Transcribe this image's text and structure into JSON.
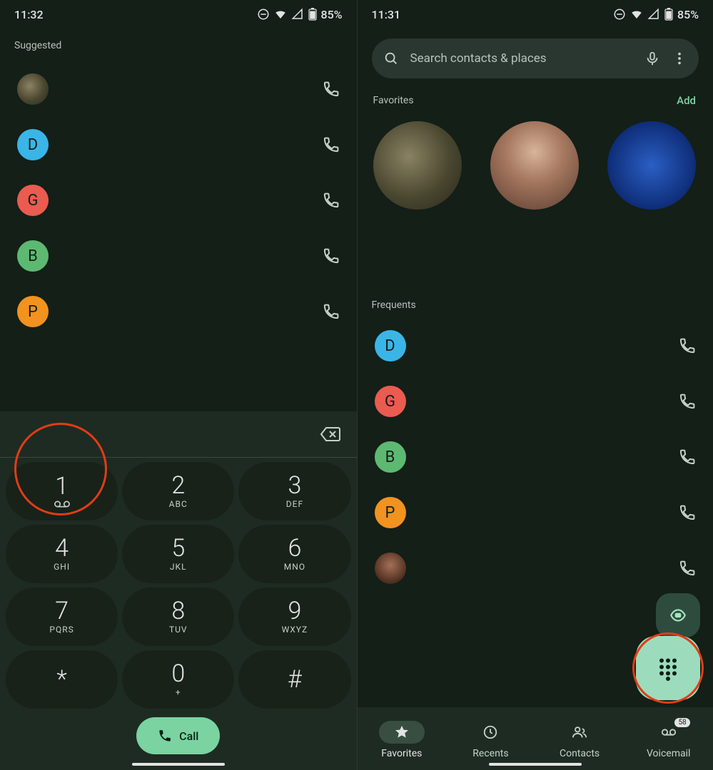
{
  "left": {
    "time": "11:32",
    "battery": "85%",
    "section": "Suggested",
    "contacts": [
      {
        "letter": "",
        "bg": "grad-horses",
        "photo": true
      },
      {
        "letter": "D",
        "bg": "#3ab5e8"
      },
      {
        "letter": "G",
        "bg": "#ea5b50"
      },
      {
        "letter": "B",
        "bg": "#5db972"
      },
      {
        "letter": "P",
        "bg": "#f2921f"
      }
    ],
    "keypad": [
      {
        "d": "1",
        "sub": "voicemail"
      },
      {
        "d": "2",
        "sub": "ABC"
      },
      {
        "d": "3",
        "sub": "DEF"
      },
      {
        "d": "4",
        "sub": "GHI"
      },
      {
        "d": "5",
        "sub": "JKL"
      },
      {
        "d": "6",
        "sub": "MNO"
      },
      {
        "d": "7",
        "sub": "PQRS"
      },
      {
        "d": "8",
        "sub": "TUV"
      },
      {
        "d": "9",
        "sub": "WXYZ"
      },
      {
        "d": "*",
        "sub": ""
      },
      {
        "d": "0",
        "sub": "+"
      },
      {
        "d": "#",
        "sub": ""
      }
    ],
    "call_label": "Call"
  },
  "right": {
    "time": "11:31",
    "battery": "85%",
    "search_placeholder": "Search contacts & places",
    "favorites_label": "Favorites",
    "add_label": "Add",
    "frequents_label": "Frequents",
    "frequents": [
      {
        "letter": "D",
        "bg": "#3ab5e8"
      },
      {
        "letter": "G",
        "bg": "#ea5b50"
      },
      {
        "letter": "B",
        "bg": "#5db972"
      },
      {
        "letter": "P",
        "bg": "#f2921f"
      },
      {
        "letter": "",
        "bg": "grad-photo2",
        "photo": true
      }
    ],
    "nav": {
      "favorites": "Favorites",
      "recents": "Recents",
      "contacts": "Contacts",
      "voicemail": "Voicemail",
      "voicemail_badge": "58"
    }
  }
}
